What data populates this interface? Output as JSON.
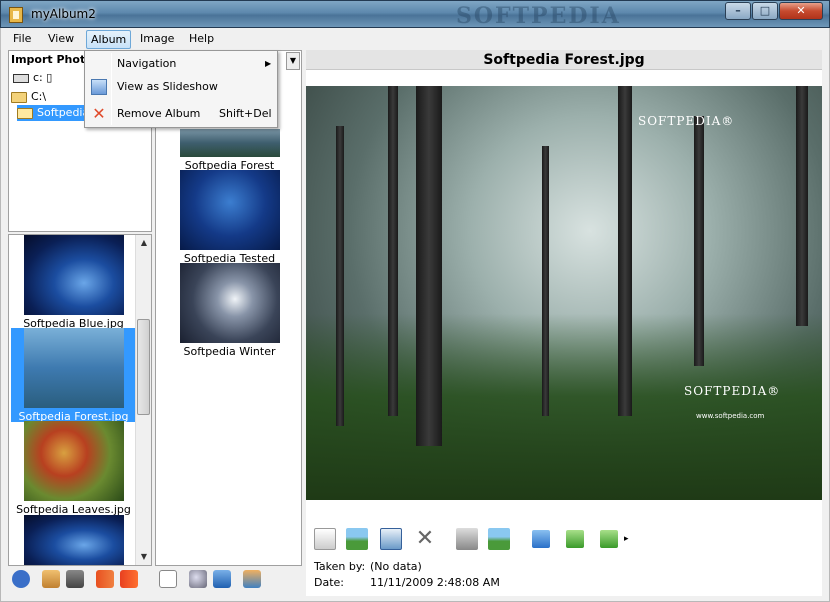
{
  "window": {
    "title": "myAlbum2",
    "watermark": "SOFTPEDIA",
    "controls": {
      "minimize": "–",
      "maximize": "□",
      "close": "✕"
    }
  },
  "menu": {
    "items": [
      {
        "label": "File"
      },
      {
        "label": "View"
      },
      {
        "label": "Album"
      },
      {
        "label": "Image"
      },
      {
        "label": "Help"
      }
    ],
    "album_dropdown": {
      "items": [
        {
          "label": "Navigation",
          "shortcut": "",
          "submenu_arrow": "▶",
          "icon": ""
        },
        {
          "label": "View as Slideshow",
          "shortcut": "",
          "icon": "slideshow-icon"
        },
        {
          "label": "Remove Album",
          "shortcut": "Shift+Del",
          "icon": "remove-x-icon"
        }
      ]
    }
  },
  "tree": {
    "header": "Import Photo",
    "drive": "c: ▯",
    "root": "C:\\",
    "selected_folder": "Softpedia"
  },
  "left_thumbnails": [
    {
      "caption": "Softpedia Blue.jpg",
      "style": "blue",
      "selected": false
    },
    {
      "caption": "Softpedia Forest.jpg",
      "style": "forest",
      "selected": true
    },
    {
      "caption": "Softpedia Leaves.jpg",
      "style": "leaves",
      "selected": false
    },
    {
      "caption": "",
      "style": "blue",
      "selected": false
    }
  ],
  "middle_thumbnails": [
    {
      "caption": "Softpedia Forest",
      "style": "forest"
    },
    {
      "caption": "Softpedia Tested",
      "style": "tested"
    },
    {
      "caption": "Softpedia Winter",
      "style": "winter"
    }
  ],
  "preview": {
    "title": "Softpedia Forest.jpg",
    "logo_top": "SOFTPEDIA®",
    "logo_bottom": "SOFTPEDIA®",
    "logo_url": "www.softpedia.com",
    "toolbar_more": "▸"
  },
  "info": {
    "taken_by_label": "Taken by:",
    "taken_by_value": "(No data)",
    "date_label": "Date:",
    "date_value": "11/11/2009 2:48:08 AM"
  },
  "colors": {
    "selection": "#3399ff",
    "menu_active_border": "#6ea8d8",
    "close_button": "#c64a2e"
  }
}
